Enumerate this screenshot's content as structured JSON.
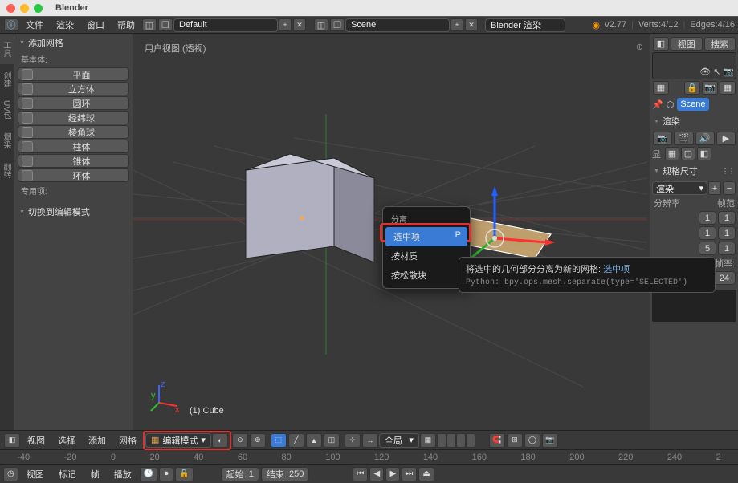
{
  "app_title": "Blender",
  "topmenu": {
    "file": "文件",
    "render": "渲染",
    "window": "窗口",
    "help": "帮助"
  },
  "layout_dropdown": "Default",
  "scene_dropdown": "Scene",
  "engine_dropdown": "Blender 渲染",
  "version": "v2.77",
  "stats": {
    "verts": "Verts:4/12",
    "edges": "Edges:4/16"
  },
  "tool_panel": {
    "title": "添加网格",
    "primitives_label": "基本体:",
    "items": [
      "平面",
      "立方体",
      "圆环",
      "经纬球",
      "棱角球",
      "柱体",
      "锥体",
      "环体"
    ],
    "special_label": "专用项:",
    "switch_header": "切换到编辑模式"
  },
  "left_tabs": [
    "工具",
    "创建",
    "UV包裹",
    "烟染",
    "翻转"
  ],
  "viewport": {
    "label": "用户视图 (透视)",
    "object_label": "(1) Cube"
  },
  "ctx_menu": {
    "title": "分离",
    "items": [
      {
        "label": "选中项",
        "hotkey": "P",
        "selected": true
      },
      {
        "label": "按材质",
        "hotkey": "",
        "selected": false
      },
      {
        "label": "按松散块",
        "hotkey": "",
        "selected": false
      }
    ]
  },
  "tooltip": {
    "desc": "将选中的几何部分分离为新的网格:",
    "highlight": "选中项",
    "python": "Python: bpy.ops.mesh.separate(type='SELECTED')"
  },
  "viewport_menu": {
    "view": "视图",
    "select": "选择",
    "add": "添加",
    "mesh": "网格"
  },
  "mode": "编辑模式",
  "orientation": "全局",
  "right_panel": {
    "view": "视图",
    "search": "搜索",
    "scene": "Scene",
    "render_header": "渲染",
    "display_label": "显",
    "dim_header": "规格尺寸",
    "render_btn": "渲染",
    "resolution": "分辨率",
    "framerange": "帧范",
    "nums_row1": [
      "1",
      "1"
    ],
    "nums_row2": [
      "1",
      "1"
    ],
    "nums_row3": [
      "5",
      "1"
    ],
    "aspect": "纵横比",
    "fps_label": "帧率:",
    "fps_val": "24"
  },
  "timeline": {
    "ticks": [
      "-40",
      "-20",
      "0",
      "20",
      "40",
      "60",
      "80",
      "100",
      "120",
      "140",
      "160",
      "180",
      "200",
      "220",
      "240",
      "2"
    ],
    "menu": {
      "view": "视图",
      "marker": "标记",
      "frame": "帧",
      "playback": "播放"
    },
    "start_label": "起始:",
    "start_val": "1",
    "end_label": "结束:",
    "end_val": "250",
    "play_icons": [
      "⏮",
      "◀",
      "▶",
      "⏭",
      "⏏"
    ]
  }
}
